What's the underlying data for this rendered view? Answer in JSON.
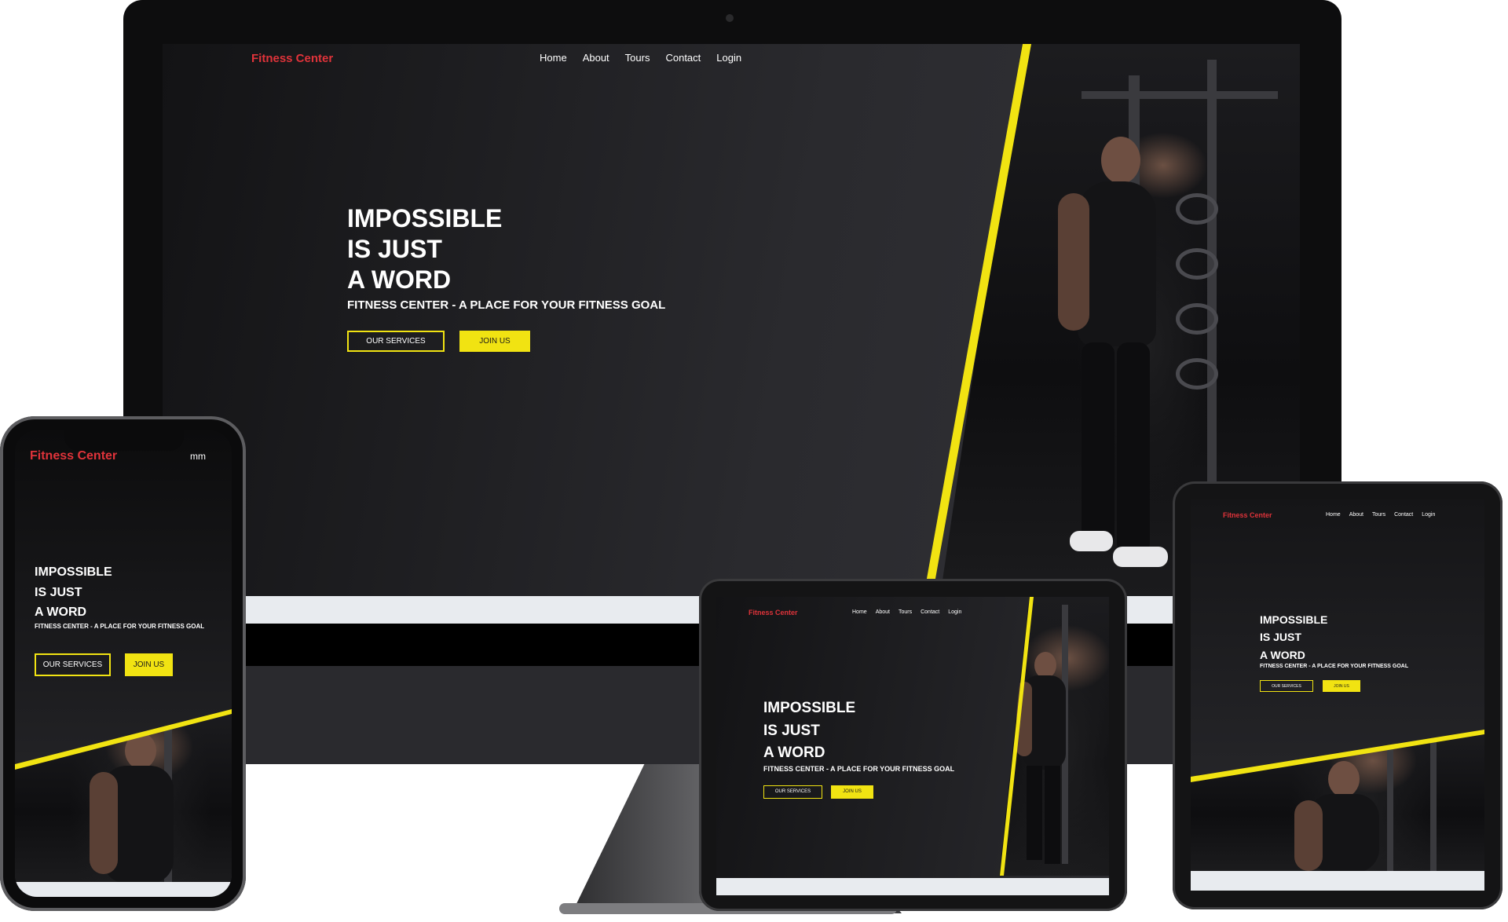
{
  "brand": "Fitness Center",
  "nav": [
    "Home",
    "About",
    "Tours",
    "Contact",
    "Login"
  ],
  "hero": {
    "line1": "IMPOSSIBLE",
    "line2": "IS JUST",
    "line3": "A WORD",
    "subtitle": "FITNESS CENTER - A PLACE FOR YOUR FITNESS GOAL",
    "btn_services": "OUR SERVICES",
    "btn_join": "JOIN US"
  },
  "phone": {
    "menu_label": "mm"
  },
  "colors": {
    "brand": "#e0333a",
    "accent": "#f1e312",
    "bg_dark": "#1d1d20"
  }
}
